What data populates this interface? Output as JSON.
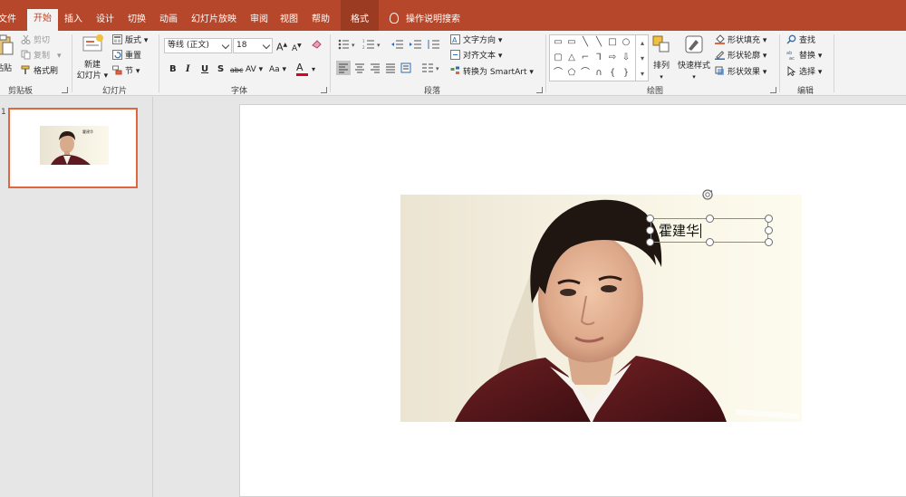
{
  "tabs": [
    {
      "label": "文件"
    },
    {
      "label": "开始"
    },
    {
      "label": "插入"
    },
    {
      "label": "设计"
    },
    {
      "label": "切换"
    },
    {
      "label": "动画"
    },
    {
      "label": "幻灯片放映"
    },
    {
      "label": "审阅"
    },
    {
      "label": "视图"
    },
    {
      "label": "帮助"
    },
    {
      "label": "格式"
    }
  ],
  "tell_me": "操作说明搜索",
  "clipboard": {
    "paste": "粘贴",
    "cut": "剪切",
    "copy": "复制",
    "format_painter": "格式刷",
    "group_label": "剪贴板"
  },
  "slides": {
    "new_slide_line1": "新建",
    "new_slide_line2": "幻灯片",
    "layout": "版式",
    "reset": "重置",
    "section": "节",
    "group_label": "幻灯片"
  },
  "font": {
    "family": "等线 (正文)",
    "size": "18",
    "bold": "B",
    "italic": "I",
    "underline": "U",
    "shadow": "S",
    "strike": "abc",
    "spacing": "AV",
    "case": "Aa",
    "color": "A",
    "grow": "A",
    "shrink": "A",
    "group_label": "字体"
  },
  "paragraph": {
    "text_direction": "文字方向",
    "align_text": "对齐文本",
    "smartart": "转换为 SmartArt",
    "group_label": "段落"
  },
  "drawing": {
    "arrange": "排列",
    "quick_styles": "快速样式",
    "fill": "形状填充",
    "outline": "形状轮廓",
    "effects": "形状效果",
    "group_label": "绘图"
  },
  "editing": {
    "find": "查找",
    "replace": "替换",
    "select": "选择",
    "group_label": "编辑"
  },
  "thumbnail": {
    "number": "1",
    "caption": "霍建华"
  },
  "slide_textbox": "霍建华",
  "colors": {
    "ribbon_red": "#b7472a",
    "thumb_border": "#e0663f",
    "font_color_red": "#e0001b"
  }
}
